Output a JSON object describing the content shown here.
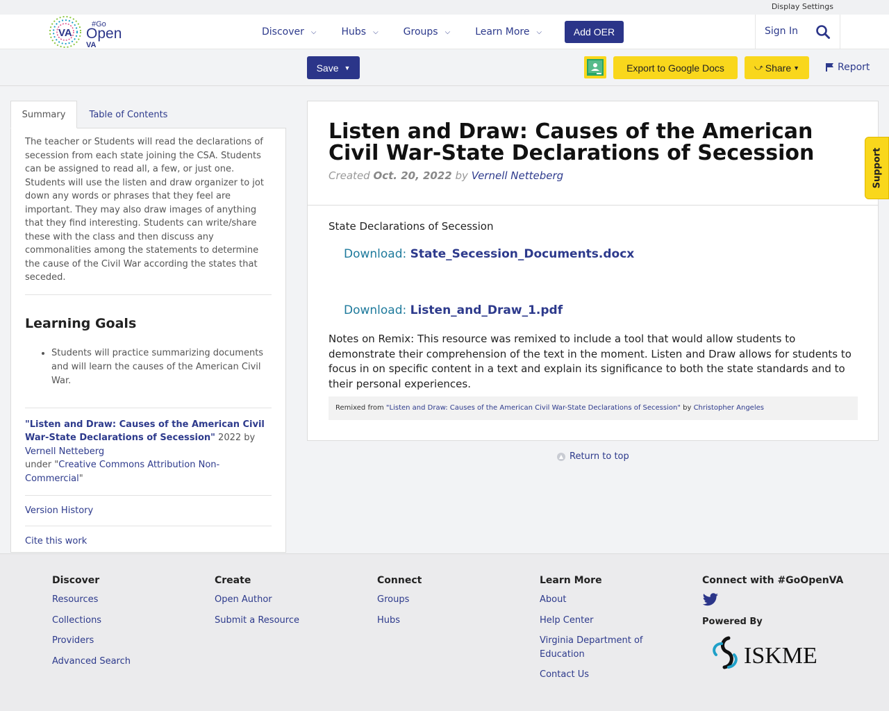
{
  "utility": {
    "display_settings": "Display Settings"
  },
  "header": {
    "logo_va": "VA",
    "logo_go": "#Go",
    "logo_open": "Open",
    "logo_va2": "VA",
    "nav": [
      {
        "label": "Discover"
      },
      {
        "label": "Hubs"
      },
      {
        "label": "Groups"
      },
      {
        "label": "Learn More"
      }
    ],
    "add_oer": "Add OER",
    "sign_in": "Sign In"
  },
  "actions": {
    "save": "Save",
    "export": "Export to Google Docs",
    "share": "Share",
    "report": "Report"
  },
  "sidebar": {
    "tabs": [
      "Summary",
      "Table of Contents"
    ],
    "summary": "The teacher or Students will read the declarations of secession from each state joining the CSA. Students can be assigned to read all, a few, or just one. Students will use the listen and draw organizer to jot down any words or phrases that they feel are important. They may also draw images of anything that they find interesting. Students can write/share these with the class and then discuss any commonalities among the statements to determine the cause of the Civil War according the states that seceded.",
    "learning_goals_title": "Learning Goals",
    "learning_goals": [
      "Students will practice summarizing documents and will learn the causes of the American Civil War."
    ],
    "attribution": {
      "title": "\"Listen and Draw: Causes of the American Civil War-State Declarations of Secession\"",
      "year_by": " 2022 by ",
      "author": "Vernell Netteberg",
      "under": "under \"",
      "license": "Creative Commons Attribution Non-Commercial",
      "close": "\""
    },
    "version_history": "Version History",
    "cite": "Cite this work"
  },
  "content": {
    "title": "Listen and Draw: Causes of the American Civil War-State Declarations of Secession",
    "created_prefix": "Created ",
    "created_date": "Oct. 20, 2022",
    "by": " by ",
    "author": "Vernell Netteberg",
    "section_label": "State Declarations of Secession",
    "downloads": [
      {
        "prefix": "Download: ",
        "file": "State_Secession_Documents.docx"
      },
      {
        "prefix": "Download: ",
        "file": "Listen_and_Draw_1.pdf"
      }
    ],
    "notes": "Notes on Remix: This resource was remixed to include a tool that would allow students to demonstrate their comprehension of the text in the moment. Listen and Draw allows for students to focus in on specific content in a text and explain its significance to both the state standards and to their personal experiences.",
    "remix_prefix": "Remixed from ",
    "remix_title": "\"Listen and Draw: Causes of the American Civil War-State Declarations of Secession\"",
    "remix_by": " by ",
    "remix_author": "Christopher Angeles",
    "return_top": "Return to top"
  },
  "support": "Support",
  "footer": {
    "discover": {
      "title": "Discover",
      "links": [
        "Resources",
        "Collections",
        "Providers",
        "Advanced Search"
      ]
    },
    "create": {
      "title": "Create",
      "links": [
        "Open Author",
        "Submit a Resource"
      ]
    },
    "connect": {
      "title": "Connect",
      "links": [
        "Groups",
        "Hubs"
      ]
    },
    "learn": {
      "title": "Learn More",
      "links": [
        "About",
        "Help Center",
        "Virginia Department of Education",
        "Contact Us"
      ]
    },
    "connect_with": "Connect with #GoOpenVA",
    "powered_by": "Powered By",
    "iskme": "ISKME"
  },
  "colors": {
    "brand": "#2b3589",
    "accent": "#f9d71c",
    "link": "#2d3a8c"
  }
}
